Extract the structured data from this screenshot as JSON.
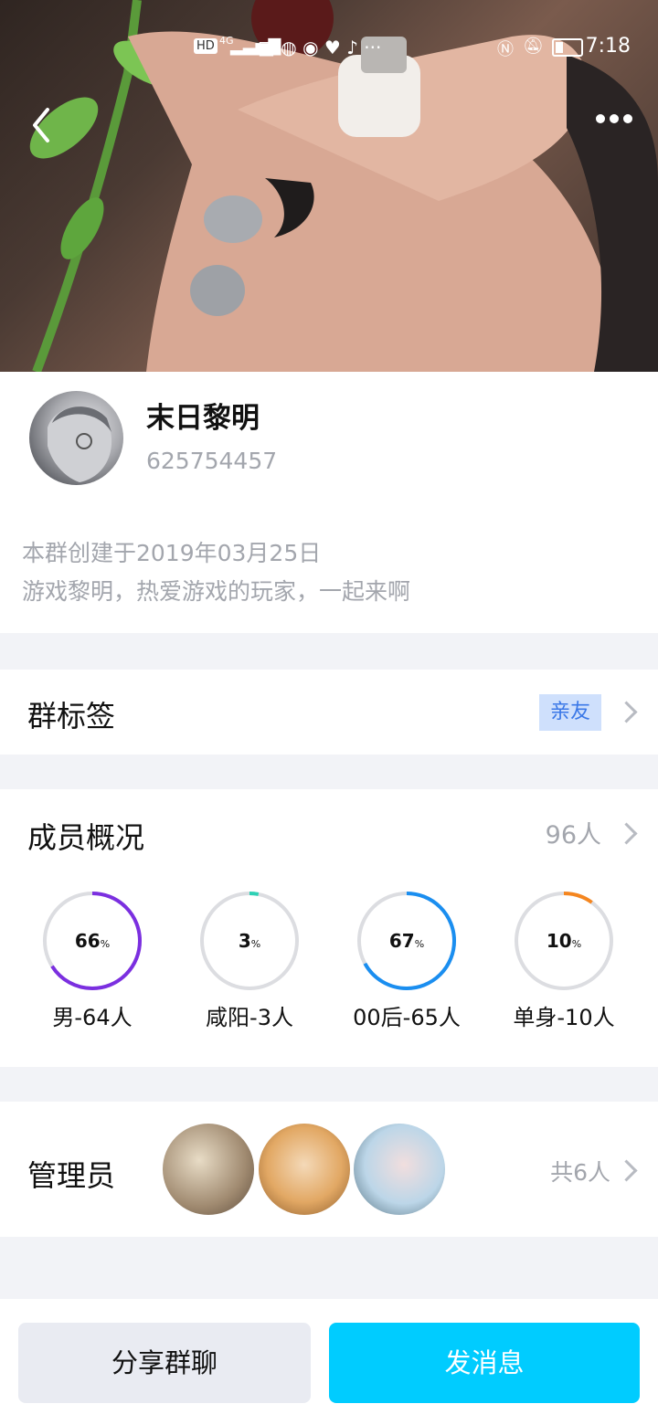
{
  "status": {
    "hd": "HD",
    "network": "4G",
    "time": "7:18"
  },
  "group": {
    "name": "末日黎明",
    "id": "625754457",
    "created": "本群创建于2019年03月25日",
    "description": "游戏黎明，热爱游戏的玩家，一起来啊"
  },
  "tags": {
    "title": "群标签",
    "badge": "亲友"
  },
  "members": {
    "title": "成员概况",
    "count": "96人",
    "stats": [
      {
        "percent": "66",
        "unit": "%",
        "label": "男-64人",
        "value": 0.66,
        "color": "#7b2fe0"
      },
      {
        "percent": "3",
        "unit": "%",
        "label": "咸阳-3人",
        "value": 0.03,
        "color": "#2ed1b5"
      },
      {
        "percent": "67",
        "unit": "%",
        "label": "00后-65人",
        "value": 0.67,
        "color": "#1a8ef0"
      },
      {
        "percent": "10",
        "unit": "%",
        "label": "单身-10人",
        "value": 0.1,
        "color": "#f5861f"
      }
    ]
  },
  "admins": {
    "title": "管理员",
    "total": "共6人"
  },
  "actions": {
    "share": "分享群聊",
    "send": "发消息"
  },
  "icons": [
    "back-icon",
    "more-icon",
    "chevron-right-icon",
    "wifi-icon",
    "signal-icon",
    "battery-icon",
    "nfc-icon",
    "mute-icon"
  ]
}
